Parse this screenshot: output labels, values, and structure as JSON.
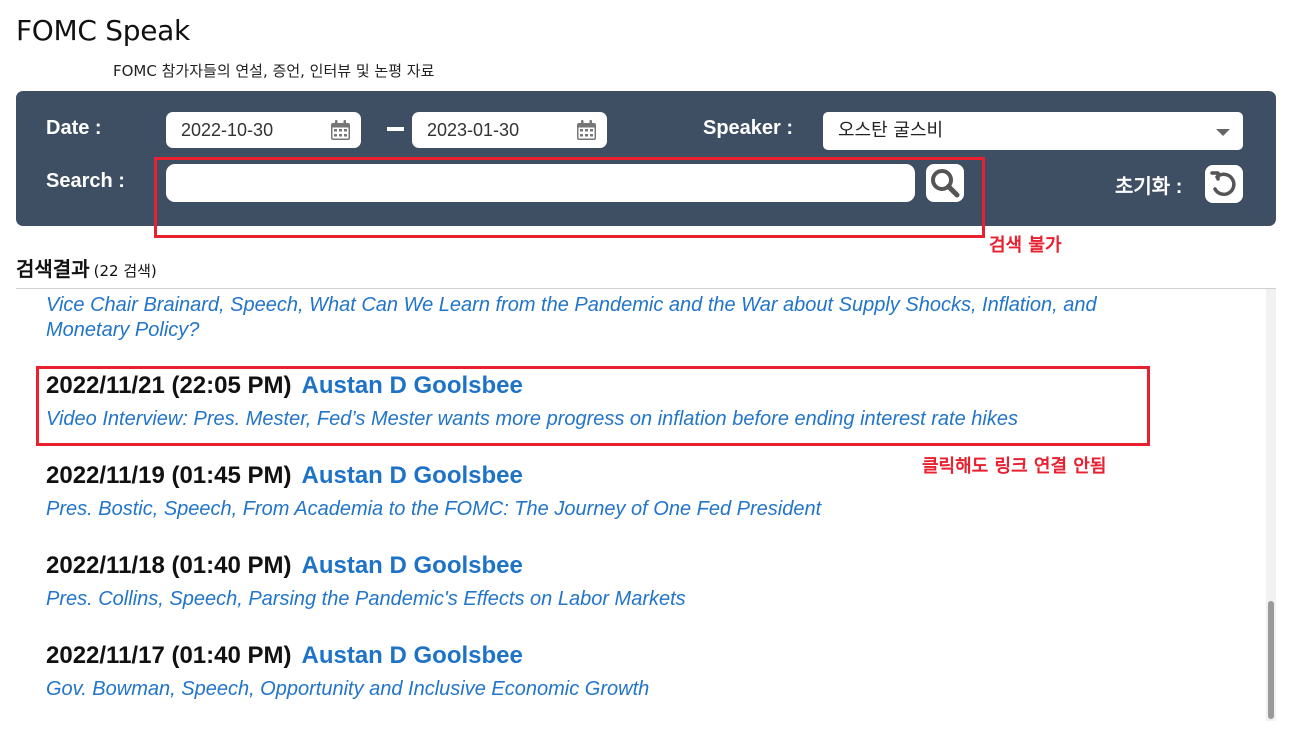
{
  "page": {
    "title": "FOMC Speak",
    "subtitle": "FOMC 참가자들의 연설, 증언, 인터뷰 및 논평 자료"
  },
  "filters": {
    "date_label": "Date :",
    "date_from": "2022-10-30",
    "date_to": "2023-01-30",
    "speaker_label": "Speaker :",
    "speaker_value": "오스탄 굴스비",
    "search_label": "Search :",
    "search_value": "",
    "reset_label": "초기화 :"
  },
  "annotations": {
    "search_note": "검색 불가",
    "link_note": "클릭해도 링크 연결 안됨",
    "color": "#e8202f"
  },
  "results": {
    "heading": "검색결과",
    "count_text": "(22 검색)",
    "partial_title_line1": "Vice Chair Brainard, Speech, What Can We Learn from the Pandemic and the War about Supply Shocks, Inflation, and",
    "partial_title_line2": "Monetary Policy?",
    "items": [
      {
        "date": "2022/11/21 (22:05 PM)",
        "speaker": "Austan D Goolsbee",
        "title": "Video Interview: Pres. Mester, Fed’s Mester wants more progress on inflation before ending interest rate hikes"
      },
      {
        "date": "2022/11/19 (01:45 PM)",
        "speaker": "Austan D Goolsbee",
        "title": "Pres. Bostic, Speech, From Academia to the FOMC: The Journey of One Fed President"
      },
      {
        "date": "2022/11/18 (01:40 PM)",
        "speaker": "Austan D Goolsbee",
        "title": "Pres. Collins, Speech, Parsing the Pandemic's Effects on Labor Markets"
      },
      {
        "date": "2022/11/17 (01:40 PM)",
        "speaker": "Austan D Goolsbee",
        "title": "Gov. Bowman, Speech, Opportunity and Inclusive Economic Growth"
      }
    ]
  },
  "colors": {
    "panel": "#3e4e63",
    "link": "#1f73c7"
  },
  "icons": [
    "calendar-icon",
    "search-icon",
    "reset-icon",
    "chevron-down-icon"
  ]
}
